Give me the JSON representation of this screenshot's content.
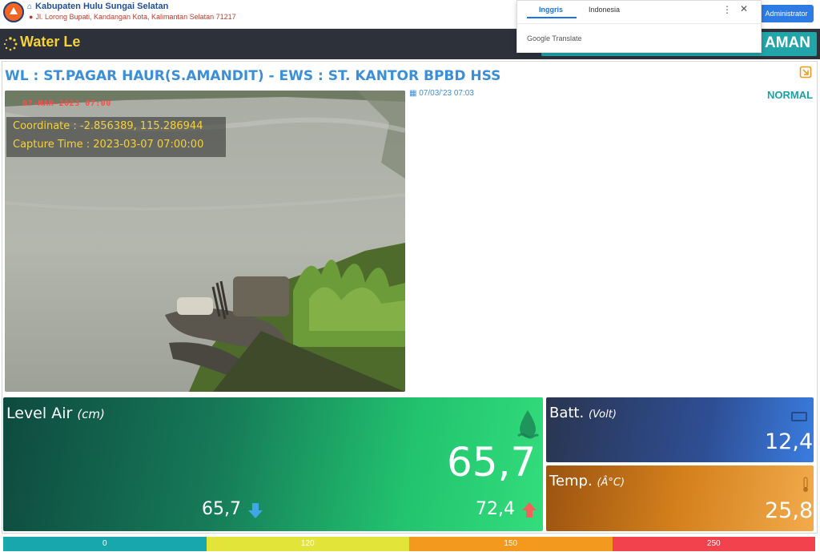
{
  "header": {
    "org_name": "Kabupaten Hulu Sungai Selatan",
    "address": "Jl. Lorong Bupati, Kandangan Kota, Kalimantan Selatan 71217",
    "admin_label": "Administrator"
  },
  "titlebar": {
    "title": "Water Le",
    "right_text": "AMAN"
  },
  "translate_popup": {
    "tabs": [
      "Inggris",
      "Indonesia"
    ],
    "active_tab": "Inggris",
    "brand": "Google Translate"
  },
  "station": {
    "title": "WL : ST.PAGAR HAUR(S.AMANDIT) - EWS : ST. KANTOR BPBD HSS",
    "timestamp": "07/03/'23 07:03",
    "status": "NORMAL"
  },
  "camera": {
    "date_overlay": "07-MAR-2023 07:00",
    "coordinate": "Coordinate : -2.856389, 115.286944",
    "capture_time": "Capture Time : 2023-03-07 07:00:00"
  },
  "level_air": {
    "label": "Level Air",
    "unit": "(cm)",
    "value": "65,7",
    "min_value": "65,7",
    "max_value": "72,4"
  },
  "battery": {
    "label": "Batt.",
    "unit": "(Volt)",
    "value": "12,4"
  },
  "temperature": {
    "label": "Temp.",
    "unit": "(Â°C)",
    "value": "25,8"
  },
  "scale": {
    "segments": [
      {
        "label": "0",
        "color": "#17a7ad"
      },
      {
        "label": "120",
        "color": "#e2e43a"
      },
      {
        "label": "150",
        "color": "#f39a1e"
      },
      {
        "label": "250",
        "color": "#f2424e"
      }
    ]
  },
  "colors": {
    "accent_blue": "#3b8fd8",
    "status_teal": "#1aa3a6",
    "title_yellow": "#f6d13a"
  }
}
